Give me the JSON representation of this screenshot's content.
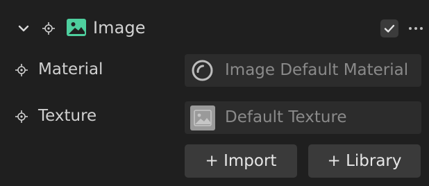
{
  "component": {
    "title": "Image",
    "enabled": true,
    "icon": "image-icon",
    "accent_color": "#4ecf9e"
  },
  "properties": [
    {
      "label": "Material",
      "value": "Image Default Material",
      "icon": "material-circle-icon"
    },
    {
      "label": "Texture",
      "value": "Default Texture",
      "icon": "texture-thumbnail-icon"
    }
  ],
  "actions": {
    "import_label": "+ Import",
    "library_label": "+ Library"
  },
  "colors": {
    "background": "#1f1f1f",
    "field": "#2c2c2c",
    "button": "#3a3a3a",
    "text": "#d0d0d0",
    "placeholder": "#8a8a8a"
  }
}
